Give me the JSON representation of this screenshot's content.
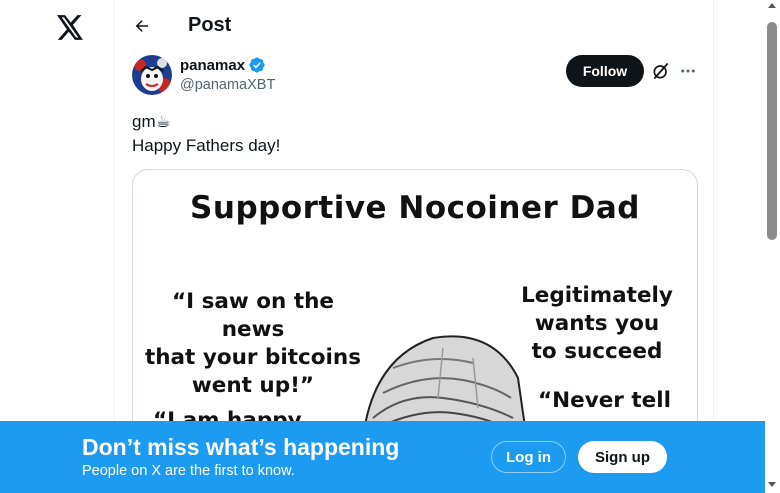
{
  "colors": {
    "accent": "#1d9bf0",
    "text": "#0f1419",
    "muted": "#536471",
    "follow_bg": "#0f1419"
  },
  "nav": {
    "logo_icon": "x-logo-icon"
  },
  "header": {
    "title": "Post",
    "back_icon": "arrow-left-icon"
  },
  "post": {
    "author_name": "panamax",
    "author_handle": "@panamaXBT",
    "verified_icon": "verified-badge-icon",
    "follow_label": "Follow",
    "grok_icon": "grok-icon",
    "more_icon": "more-dots-icon",
    "text": "gm☕\nHappy Fathers day!",
    "media": {
      "title": "Supportive Nocoiner Dad",
      "left_quote": "“I saw on the news\nthat your bitcoins\nwent up!”",
      "left_quote_2": "“I am happy",
      "right_quote": "Legitimately\nwants you\nto succeed",
      "right_quote_2": "“Never tell"
    }
  },
  "banner": {
    "title": "Don’t miss what’s happening",
    "subtitle": "People on X are the first to know.",
    "login_label": "Log in",
    "signup_label": "Sign up"
  }
}
